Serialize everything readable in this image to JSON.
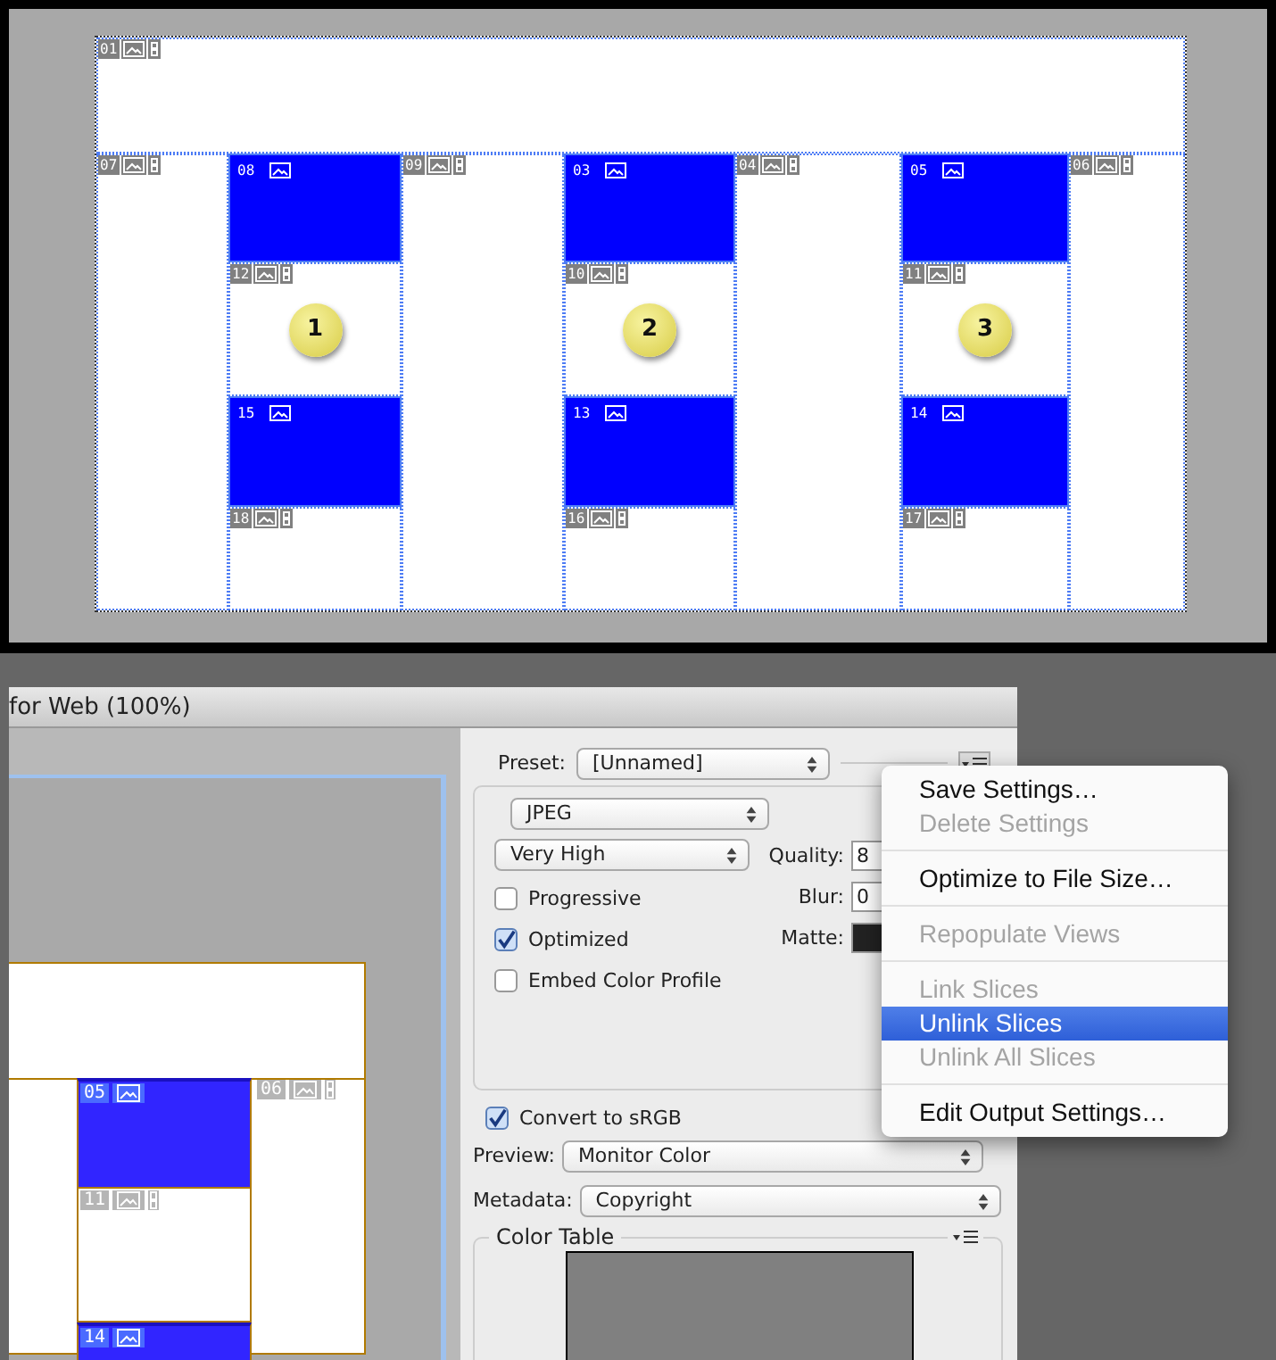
{
  "slice_diagram": {
    "slices": [
      {
        "label": "01",
        "kind": "auto"
      },
      {
        "label": "07",
        "kind": "auto"
      },
      {
        "label": "08",
        "kind": "user"
      },
      {
        "label": "09",
        "kind": "auto"
      },
      {
        "label": "03",
        "kind": "user"
      },
      {
        "label": "04",
        "kind": "auto"
      },
      {
        "label": "05",
        "kind": "user"
      },
      {
        "label": "06",
        "kind": "auto"
      },
      {
        "label": "12",
        "kind": "auto",
        "marker": "1"
      },
      {
        "label": "10",
        "kind": "auto",
        "marker": "2"
      },
      {
        "label": "11",
        "kind": "auto",
        "marker": "3"
      },
      {
        "label": "15",
        "kind": "user"
      },
      {
        "label": "13",
        "kind": "user"
      },
      {
        "label": "14",
        "kind": "user"
      },
      {
        "label": "18",
        "kind": "auto"
      },
      {
        "label": "16",
        "kind": "auto"
      },
      {
        "label": "17",
        "kind": "auto"
      }
    ]
  },
  "window": {
    "title": "for Web (100%)"
  },
  "preview": {
    "slices": [
      {
        "label": "05",
        "kind": "user"
      },
      {
        "label": "06",
        "kind": "auto"
      },
      {
        "label": "11",
        "kind": "auto"
      },
      {
        "label": "14",
        "kind": "user"
      }
    ]
  },
  "settings": {
    "preset": {
      "label": "Preset:",
      "value": "[Unnamed]"
    },
    "format": "JPEG",
    "quality_preset": "Very High",
    "checkboxes": [
      {
        "label": "Progressive",
        "checked": false
      },
      {
        "label": "Optimized",
        "checked": true
      },
      {
        "label": "Embed Color Profile",
        "checked": false
      }
    ],
    "fields": [
      {
        "label": "Quality:",
        "kind": "text",
        "value": "8"
      },
      {
        "label": "Blur:",
        "kind": "text",
        "value": "0"
      },
      {
        "label": "Matte:",
        "kind": "swatch"
      }
    ],
    "convert": {
      "label": "Convert to sRGB",
      "checked": true
    },
    "preview": {
      "label": "Preview:",
      "value": "Monitor Color"
    },
    "metadata": {
      "label": "Metadata:",
      "value": "Copyright"
    },
    "color_table": {
      "title": "Color Table"
    }
  },
  "menu": {
    "groups": [
      [
        {
          "label": "Save Settings…",
          "disabled": false,
          "selected": false
        },
        {
          "label": "Delete Settings",
          "disabled": true,
          "selected": false
        }
      ],
      [
        {
          "label": "Optimize to File Size…",
          "disabled": false,
          "selected": false
        }
      ],
      [
        {
          "label": "Repopulate Views",
          "disabled": true,
          "selected": false
        }
      ],
      [
        {
          "label": "Link Slices",
          "disabled": true,
          "selected": false
        },
        {
          "label": "Unlink Slices",
          "disabled": false,
          "selected": true
        },
        {
          "label": "Unlink All Slices",
          "disabled": true,
          "selected": false
        }
      ],
      [
        {
          "label": "Edit Output Settings…",
          "disabled": false,
          "selected": false
        }
      ]
    ]
  }
}
